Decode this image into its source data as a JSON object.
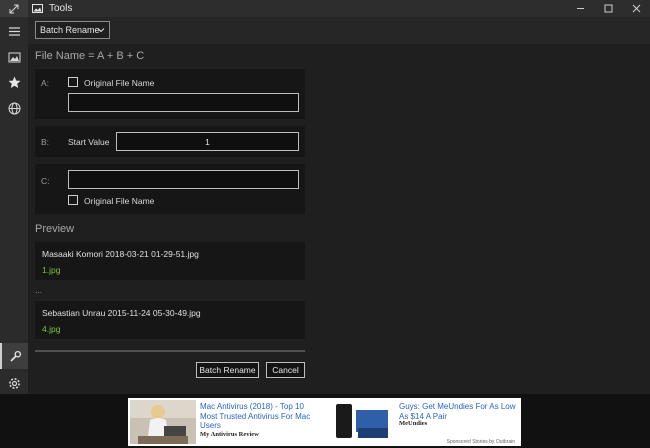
{
  "window": {
    "title": "Tools"
  },
  "toolbar": {
    "mode_label": "Batch Rename"
  },
  "formula": {
    "text": "File Name = A + B + C"
  },
  "part_a": {
    "label": "A:",
    "checkbox_label": "Original File Name",
    "value": ""
  },
  "part_b": {
    "label": "B:",
    "start_label": "Start Value",
    "start_value": "1"
  },
  "part_c": {
    "label": "C:",
    "value": "",
    "checkbox_label": "Original File Name"
  },
  "preview": {
    "title": "Preview",
    "items": [
      {
        "original": "Masaaki Komori  2018-03-21 01-29-51.jpg",
        "new": "1.jpg"
      },
      {
        "original": "Sebastian Unrau  2015-11-24 05-30-49.jpg",
        "new": "4.jpg"
      }
    ],
    "ellipsis": "..."
  },
  "actions": {
    "rename_label": "Batch Rename",
    "cancel_label": "Cancel"
  },
  "ad": {
    "left": {
      "headline": "Mac Antivirus (2018) - Top 10 Most Trusted Antivirus For Mac Users",
      "source": "My Antivirus Review"
    },
    "right": {
      "headline": "Guys: Get MeUndies For As Low As $14 A Pair",
      "source": "MeUndies"
    },
    "footer": "Sponsored Stories by Outbrain"
  },
  "colors": {
    "accent_green": "#7ec23c",
    "link_blue": "#2b63c6"
  }
}
